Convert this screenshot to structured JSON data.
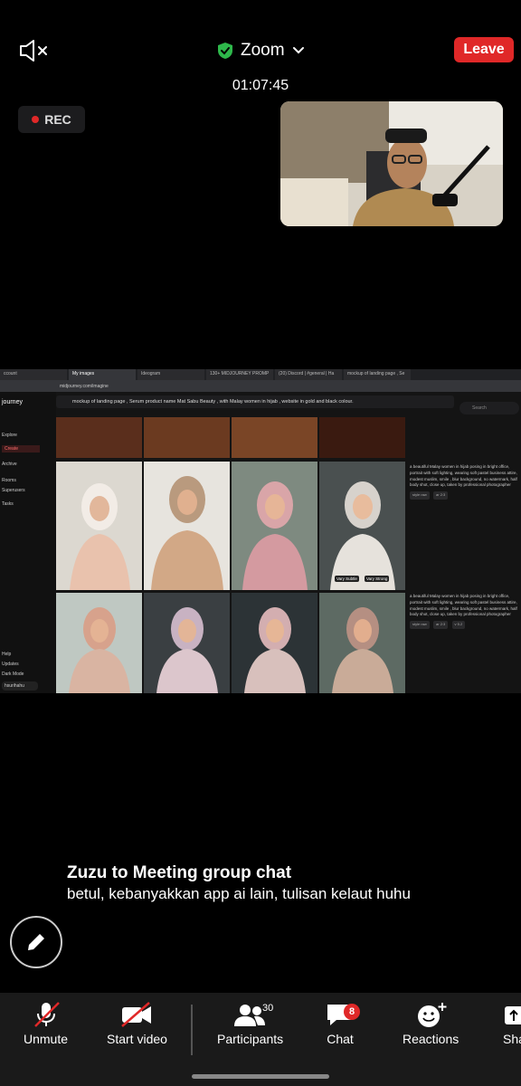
{
  "header": {
    "app_title": "Zoom",
    "leave_label": "Leave",
    "timer": "01:07:45",
    "rec_label": "REC",
    "shield_color": "#2eb84b"
  },
  "shared_screen": {
    "tabs": [
      "ccount",
      "My images",
      "Ideogram",
      "130+ MIDJOURNEY PROMP",
      "(20) Discord | #general | Ha",
      "mockup of landing page , Se"
    ],
    "url": "midjourney.com/imagine",
    "sidebar": {
      "logo": "journey",
      "items": [
        "Explore",
        "Create",
        "Archive",
        "Rooms",
        "Superusers",
        "Tasks",
        "Help",
        "Updates",
        "Dark Mode",
        "hsurihahu"
      ]
    },
    "prompt": "mockup of landing page , Serum product name Mat Sabu Beauty , with Malay women in hijab , website in gold and black colour.",
    "search_placeholder": "Search",
    "description_1": "a beautiful Malay women in hijab posing in bright office, portrait with soft lighting, wearing soft pastel business attire, modest muslim, smile , blur background, no watermark, half body shot, close up, taken by professional photographer",
    "chips_1": [
      "style raw",
      "ar 2:3"
    ],
    "description_2": "a beautiful Malay women in hijab posing in bright office, portrait with soft lighting, wearing soft pastel business attire, modest muslim, smile , blur background, no watermark, half body shot, close up, taken by professional photographer",
    "chips_2": [
      "style raw",
      "ar 2:3",
      "v 5.2"
    ],
    "vary_subtle": "Vary Subtle",
    "vary_strong": "Vary Strong"
  },
  "chat": {
    "title": "Zuzu to Meeting group chat",
    "message": "betul, kebanyakkan app ai lain, tulisan kelaut huhu"
  },
  "toolbar": {
    "unmute": "Unmute",
    "start_video": "Start video",
    "participants": "Participants",
    "participants_count": "30",
    "chat": "Chat",
    "chat_badge": "8",
    "reactions": "Reactions",
    "share": "Sha"
  }
}
